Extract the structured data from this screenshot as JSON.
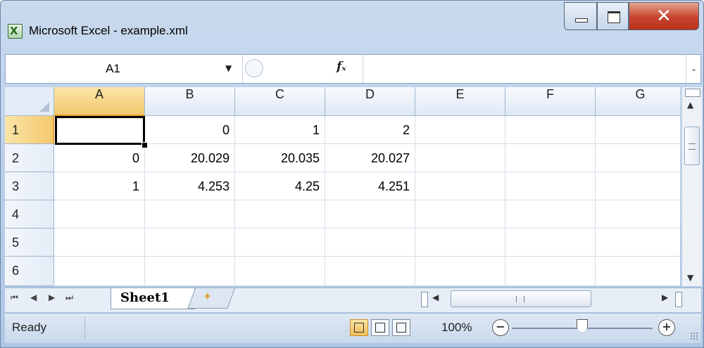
{
  "window": {
    "title": "Microsoft Excel - example.xml",
    "app_icon_glyph": "X"
  },
  "formula_bar": {
    "name_box": "A1",
    "fx_label": "fx",
    "content": ""
  },
  "grid": {
    "columns": [
      "A",
      "B",
      "C",
      "D",
      "E",
      "F",
      "G"
    ],
    "rows": [
      {
        "header": "1",
        "cells": [
          "",
          "0",
          "1",
          "2",
          "",
          "",
          ""
        ]
      },
      {
        "header": "2",
        "cells": [
          "0",
          "20.029",
          "20.035",
          "20.027",
          "",
          "",
          ""
        ]
      },
      {
        "header": "3",
        "cells": [
          "1",
          "4.253",
          "4.25",
          "4.251",
          "",
          "",
          ""
        ]
      },
      {
        "header": "4",
        "cells": [
          "",
          "",
          "",
          "",
          "",
          "",
          ""
        ]
      },
      {
        "header": "5",
        "cells": [
          "",
          "",
          "",
          "",
          "",
          "",
          ""
        ]
      },
      {
        "header": "6",
        "cells": [
          "",
          "",
          "",
          "",
          "",
          "",
          ""
        ]
      }
    ],
    "active_cell": "A1",
    "selection_color": "#f4c96e"
  },
  "sheets": {
    "tabs": [
      "Sheet1"
    ],
    "active": "Sheet1",
    "new_sheet_icon": "insert-worksheet-icon"
  },
  "status_bar": {
    "status": "Ready",
    "zoom": "100%",
    "zoom_level": 1.0
  },
  "colors": {
    "close_button": "#c7432c",
    "header_bg": "#dfe8f5",
    "window_frame": "#b7cde8"
  }
}
